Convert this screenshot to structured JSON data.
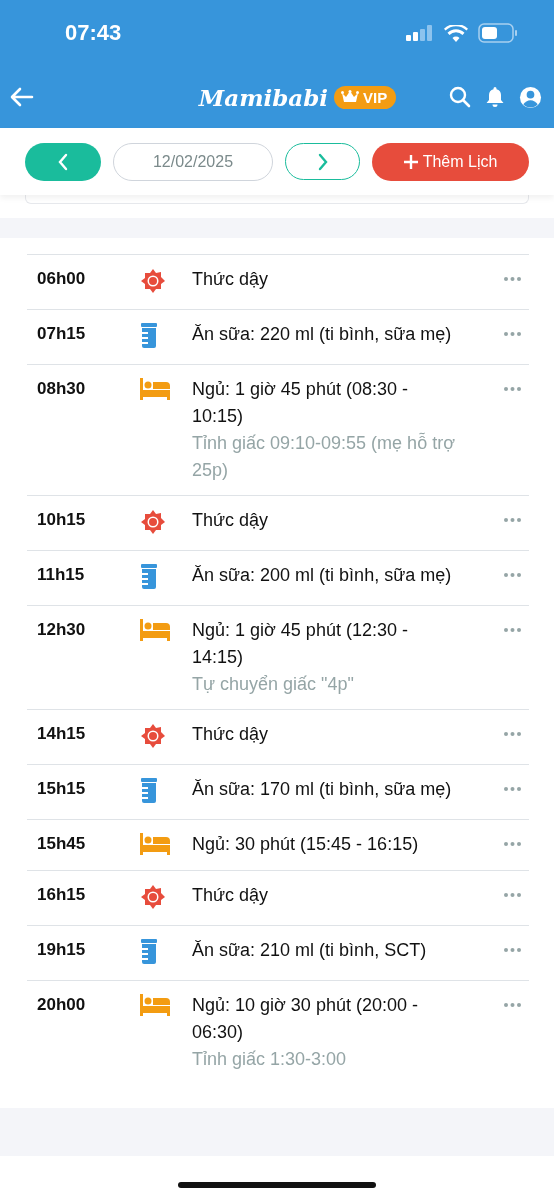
{
  "status_bar": {
    "time": "07:43"
  },
  "header": {
    "logo": "Mamibabi",
    "badge": "VIP"
  },
  "date_bar": {
    "date": "12/02/2025",
    "add_button": "Thêm Lịch"
  },
  "entries": [
    {
      "time": "06h00",
      "kind": "wake",
      "text": "Thức dậy"
    },
    {
      "time": "07h15",
      "kind": "feed",
      "text": "Ăn sữa: 220 ml (ti bình, sữa mẹ)"
    },
    {
      "time": "08h30",
      "kind": "sleep",
      "text": "Ngủ: 1 giờ 45 phút (08:30 - 10:15)",
      "note": "Tỉnh giấc 09:10-09:55 (mẹ hỗ trợ 25p)"
    },
    {
      "time": "10h15",
      "kind": "wake",
      "text": "Thức dậy"
    },
    {
      "time": "11h15",
      "kind": "feed",
      "text": "Ăn sữa: 200 ml (ti bình, sữa mẹ)"
    },
    {
      "time": "12h30",
      "kind": "sleep",
      "text": "Ngủ: 1 giờ 45 phút (12:30 - 14:15)",
      "note": "Tự chuyển giấc \"4p\""
    },
    {
      "time": "14h15",
      "kind": "wake",
      "text": "Thức dậy"
    },
    {
      "time": "15h15",
      "kind": "feed",
      "text": "Ăn sữa: 170 ml (ti bình, sữa mẹ)"
    },
    {
      "time": "15h45",
      "kind": "sleep",
      "text": "Ngủ: 30 phút (15:45 - 16:15)"
    },
    {
      "time": "16h15",
      "kind": "wake",
      "text": "Thức dậy"
    },
    {
      "time": "19h15",
      "kind": "feed",
      "text": "Ăn sữa: 210 ml (ti bình, SCT)"
    },
    {
      "time": "20h00",
      "kind": "sleep",
      "text": "Ngủ: 10 giờ 30 phút (20:00 - 06:30)",
      "note": "Tỉnh giấc 1:30-3:00"
    }
  ]
}
